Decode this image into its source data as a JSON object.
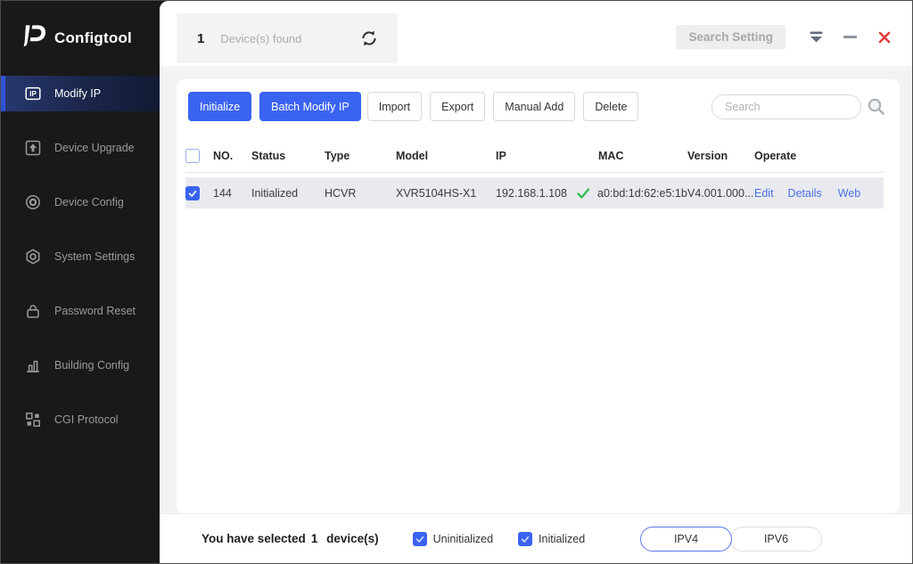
{
  "app": {
    "name": "Configtool"
  },
  "colors": {
    "primary_blue": "#3b63f1",
    "link_blue": "#4d6fe3",
    "success_green": "#2fbe52",
    "close_red": "#e23c3c",
    "sidebar_bg": "#191919",
    "active_item_navy": "#1a2547",
    "row_highlight": "#e8eaef"
  },
  "sidebar": {
    "logo_text": "Configtool",
    "logo_icon": "dahua-d-logo",
    "items": [
      {
        "label": "Modify IP",
        "icon": "ip-badge-icon",
        "active": true
      },
      {
        "label": "Device Upgrade",
        "icon": "upgrade-arrow-icon",
        "active": false
      },
      {
        "label": "Device Config",
        "icon": "target-circles-icon",
        "active": false
      },
      {
        "label": "System Settings",
        "icon": "gear-icon",
        "active": false
      },
      {
        "label": "Password Reset",
        "icon": "lock-icon",
        "active": false
      },
      {
        "label": "Building Config",
        "icon": "bar-chart-icon",
        "active": false
      },
      {
        "label": "CGI Protocol",
        "icon": "grid-squares-icon",
        "active": false
      }
    ]
  },
  "topbar": {
    "device_count": "1",
    "device_found_label": "Device(s) found",
    "refresh_icon": "refresh-icon",
    "search_setting_label": "Search Setting",
    "collapse_icon": "dropdown-caret-icon",
    "minimize_icon": "minimize-icon",
    "close_icon": "close-icon"
  },
  "toolbar": {
    "buttons": [
      {
        "label": "Initialize",
        "style": "primary"
      },
      {
        "label": "Batch Modify IP",
        "style": "primary"
      },
      {
        "label": "Import",
        "style": "secondary"
      },
      {
        "label": "Export",
        "style": "secondary"
      },
      {
        "label": "Manual Add",
        "style": "secondary"
      },
      {
        "label": "Delete",
        "style": "secondary"
      }
    ],
    "search_placeholder": "Search",
    "search_icon": "search-magnifier-icon"
  },
  "table": {
    "columns": [
      "NO.",
      "Status",
      "Type",
      "Model",
      "IP",
      "MAC",
      "Version",
      "Operate"
    ],
    "header_checkbox_checked": false,
    "rows": [
      {
        "selected": true,
        "no": "144",
        "status": "Initialized",
        "type": "HCVR",
        "model": "XVR5104HS-X1",
        "ip": "192.168.1.108",
        "mac_verified_icon": "green-check-icon",
        "mac": "a0:bd:1d:62:e5:1b",
        "version": "V4.001.000...",
        "operate": [
          "Edit",
          "Details",
          "Web"
        ]
      }
    ]
  },
  "footer": {
    "selected_prefix": "You have selected",
    "selected_count": "1",
    "selected_suffix": "device(s)",
    "filters": [
      {
        "label": "Uninitialized",
        "checked": true
      },
      {
        "label": "Initialized",
        "checked": true
      }
    ],
    "ip_tabs": [
      {
        "label": "IPV4",
        "active": true
      },
      {
        "label": "IPV6",
        "active": false
      }
    ]
  }
}
